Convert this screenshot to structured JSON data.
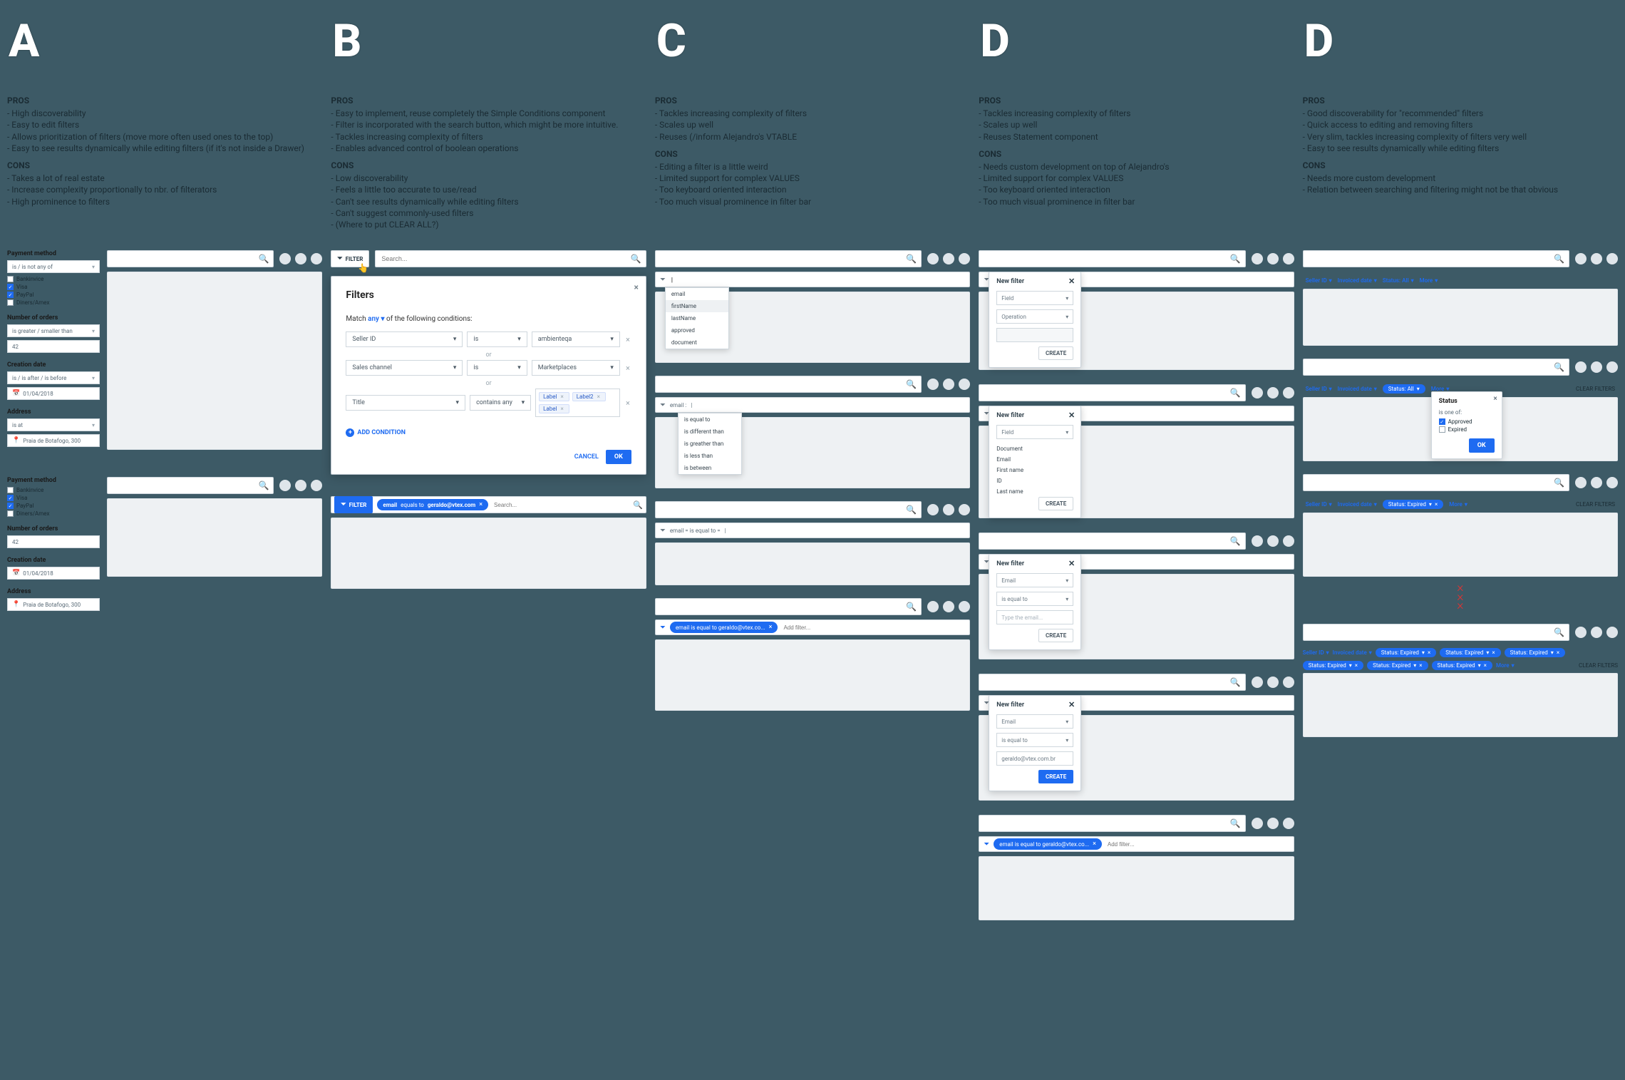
{
  "columns": [
    "A",
    "B",
    "C",
    "D",
    "D"
  ],
  "A": {
    "pros_title": "PROS",
    "pros": [
      "High discoverability",
      "Easy to edit filters",
      "Allows prioritization of filters (move more often used ones to the top)",
      "Easy to see results dynamically while editing filters (if it's not inside a Drawer)"
    ],
    "cons_title": "CONS",
    "cons": [
      "Takes a lot of real estate",
      "Increase complexity proportionally to nbr. of filterators",
      "High prominence to filters"
    ],
    "filters1": {
      "payment": {
        "label": "Payment method",
        "op": "is / is not any of",
        "opts": [
          "Bankinvice",
          "Visa",
          "PayPal",
          "Diners/Amex"
        ],
        "checked": [
          false,
          true,
          true,
          false
        ]
      },
      "orders": {
        "label": "Number of orders",
        "op": "is greater / smaller than",
        "val": "42"
      },
      "creation": {
        "label": "Creation date",
        "op": "is / is after / is before",
        "val": "01/04/2018"
      },
      "address": {
        "label": "Address",
        "op": "is at",
        "val": "Praia de Botafogo, 300"
      }
    },
    "filters2": {
      "payment": {
        "label": "Payment method",
        "opts": [
          "Bankinvice",
          "Visa",
          "PayPal",
          "Diners/Amex"
        ],
        "checked": [
          false,
          true,
          true,
          false
        ]
      },
      "orders": {
        "label": "Number of orders",
        "val": "42"
      },
      "creation": {
        "label": "Creation date",
        "val": "01/04/2018"
      },
      "address": {
        "label": "Address",
        "val": "Praia de Botafogo, 300"
      }
    }
  },
  "B": {
    "pros_title": "PROS",
    "pros": [
      "Easy to implement, reuse completely the Simple Conditions component",
      "Filter is incorporated with the search button, which might be more intuitive.",
      "Tackles increasing complexity of filters",
      "Enables advanced control of boolean operations"
    ],
    "cons_title": "CONS",
    "cons": [
      "Low discoverability",
      "Feels a little too accurate to use/read",
      "Can't see results dynamically while editing filters",
      "Can't suggest commonly-used filters",
      "(Where to put CLEAR ALL?)"
    ],
    "filter_btn": "FILTER",
    "search_ph": "Search...",
    "modal": {
      "title": "Filters",
      "match_pre": "Match",
      "match_any": "any",
      "match_post": "of the following conditions:",
      "rows": [
        {
          "field": "Seller ID",
          "op": "is",
          "val": "ambienteqa"
        },
        {
          "field": "Sales channel",
          "op": "is",
          "val": "Marketplaces"
        },
        {
          "field": "Title",
          "op": "contains any",
          "chips": [
            "Label",
            "Label2",
            "Label"
          ]
        }
      ],
      "or": "or",
      "add": "ADD CONDITION",
      "cancel": "CANCEL",
      "ok": "OK"
    },
    "result": {
      "btn": "FILTER",
      "pill_a": "email",
      "pill_b": "equals to",
      "pill_c": "geraldo@vtex.com",
      "search_ph": "Search..."
    }
  },
  "C": {
    "pros_title": "PROS",
    "pros": [
      "Tackles increasing complexity of filters",
      "Scales up well",
      "Reuses (/inform Alejandro's VTABLE"
    ],
    "cons_title": "CONS",
    "cons": [
      "Editing a filter is a little weird",
      "Limited support for complex VALUES",
      "Too keyboard oriented interaction",
      "Too much visual prominence in filter bar"
    ],
    "s1": {
      "menu": [
        "email",
        "firstName",
        "lastName",
        "approved",
        "document"
      ],
      "sel": "firstName"
    },
    "s2": {
      "q": "email :",
      "menu": [
        "is equal to",
        "is different than",
        "is greather than",
        "is less than",
        "is between"
      ]
    },
    "s3": {
      "q": "email = is equal to ="
    },
    "s4": {
      "pill": "email is equal to geraldo@vtex.co...",
      "add": "Add filter..."
    }
  },
  "D": {
    "pros_title": "PROS",
    "pros": [
      "Tackles increasing complexity of filters",
      "Scales up well",
      "Reuses Statement component"
    ],
    "cons_title": "CONS",
    "cons": [
      "Needs custom development on top of Alejandro's",
      "Limited support for complex VALUES",
      "Too keyboard oriented interaction",
      "Too much visual prominence in filter bar"
    ],
    "card_title": "New filter",
    "ph_field": "Field",
    "ph_op": "Operation",
    "create": "CREATE",
    "s2": {
      "menu": [
        "Document",
        "Email",
        "First name",
        "ID",
        "Last name"
      ]
    },
    "s3": {
      "field": "Email",
      "op": "is equal to",
      "val_ph": "Type the email..."
    },
    "s4": {
      "field": "Email",
      "op": "is equal to",
      "val": "geraldo@vtex.com.br"
    },
    "result": {
      "pill": "email is equal to geraldo@vtex.co...",
      "add": "Add filter..."
    }
  },
  "E": {
    "pros_title": "PROS",
    "pros": [
      "Good discoverability for \"recommended\" filters",
      "Quick access to editing and removing filters",
      "Very slim, tackles increasing complexity of filters very well",
      "Easy to see results dynamically while editing filters"
    ],
    "cons_title": "CONS",
    "cons": [
      "Needs more custom development",
      "Relation between searching and filtering might not be that obvious"
    ],
    "links": [
      "Seller ID",
      "Invoiced date",
      "Status: All"
    ],
    "more": "More",
    "pop": {
      "title": "Status",
      "sub": "is one of:",
      "opts": [
        "Approved",
        "Expired"
      ],
      "checked": [
        true,
        false
      ],
      "ok": "OK"
    },
    "clear": "CLEAR FILTERS",
    "row3_pill": "Status: Expired",
    "row4_pills": [
      "Status: Expired",
      "Status: Expired",
      "Status: Expired",
      "Status: Expired",
      "Status: Expired",
      "Status: Expired"
    ]
  }
}
